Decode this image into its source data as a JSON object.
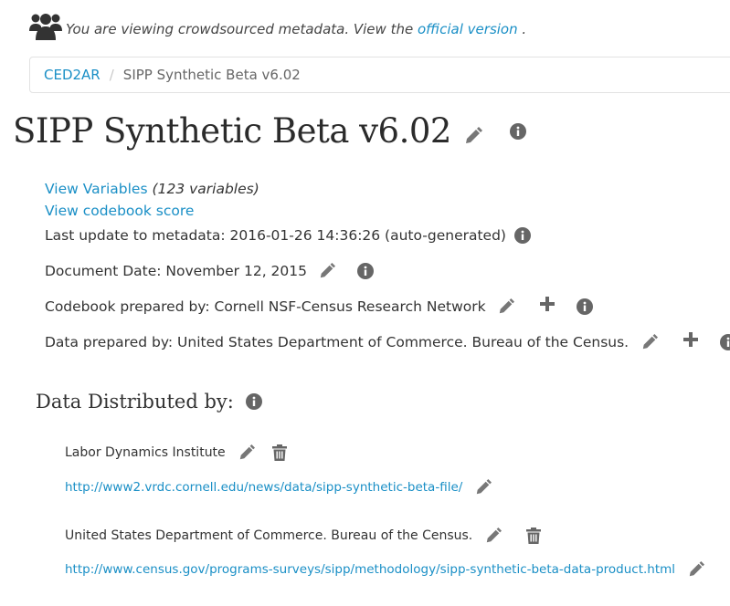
{
  "banner": {
    "message": "You are viewing crowdsourced metadata. View the",
    "link_label": "official version",
    "suffix": "."
  },
  "breadcrumb": {
    "root": "CED2AR",
    "separator": "/",
    "current": "SIPP Synthetic Beta v6.02"
  },
  "page": {
    "title": "SIPP Synthetic Beta v6.02"
  },
  "summary": {
    "view_variables_label": "View Variables",
    "variable_count": "(123 variables)",
    "view_score_label": "View codebook score",
    "last_update": "Last update to metadata: 2016-01-26 14:36:26 (auto-generated)",
    "document_date": "Document Date: November 12, 2015",
    "codebook_prepared_by": "Codebook prepared by: Cornell NSF-Census Research Network",
    "data_prepared_by": "Data prepared by: United States Department of Commerce. Bureau of the Census."
  },
  "distribution": {
    "heading": "Data Distributed by:",
    "items": [
      {
        "name": "Labor Dynamics Institute",
        "url": "http://www2.vrdc.cornell.edu/news/data/sipp-synthetic-beta-file/"
      },
      {
        "name": "United States Department of Commerce. Bureau of the Census.",
        "url": "http://www.census.gov/programs-surveys/sipp/methodology/sipp-synthetic-beta-data-product.html"
      }
    ]
  },
  "icons": {
    "users": "users-icon",
    "edit": "pencil-icon",
    "info": "info-circle-icon",
    "add": "plus-icon",
    "delete": "trash-icon"
  },
  "colors": {
    "link": "#1a8fc6",
    "icon": "#777777",
    "text": "#333333"
  }
}
